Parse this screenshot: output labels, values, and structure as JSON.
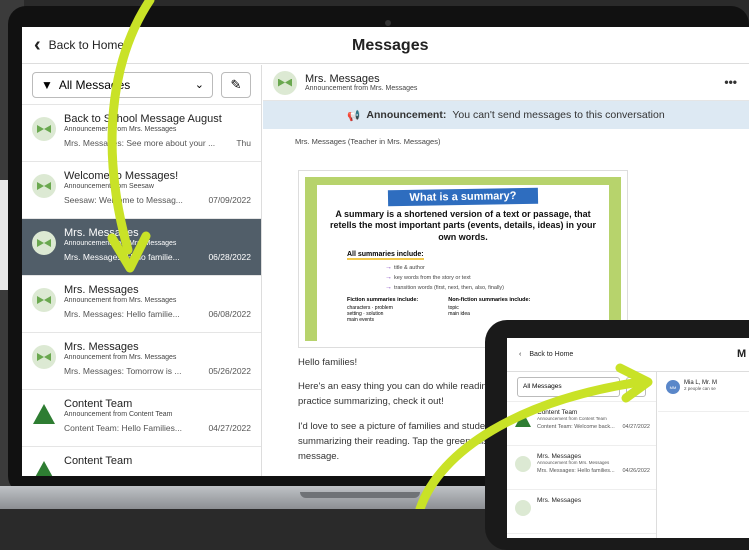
{
  "laptop": {
    "back_label": "Back to Home",
    "title": "Messages",
    "filter_label": "All Messages",
    "threads": [
      {
        "name": "Back to School Message August",
        "sub": "Announcement from Mrs. Messages",
        "preview": "Mrs. Messages: See more about your ...",
        "date": "Thu",
        "avatar": "bow"
      },
      {
        "name": "Welcome to Messages!",
        "sub": "Announcement from Seesaw",
        "preview": "Seesaw: Welcome to Messag...",
        "date": "07/09/2022",
        "avatar": "bow"
      },
      {
        "name": "Mrs. Messages",
        "sub": "Announcement from Mrs. Messages",
        "preview": "Mrs. Messages: Hello familie...",
        "date": "06/28/2022",
        "avatar": "bow"
      },
      {
        "name": "Mrs. Messages",
        "sub": "Announcement from Mrs. Messages",
        "preview": "Mrs. Messages: Hello familie...",
        "date": "06/08/2022",
        "avatar": "bow"
      },
      {
        "name": "Mrs. Messages",
        "sub": "Announcement from Mrs. Messages",
        "preview": "Mrs. Messages: Tomorrow is ...",
        "date": "05/26/2022",
        "avatar": "bow"
      },
      {
        "name": "Content Team",
        "sub": "Announcement from Content Team",
        "preview": "Content Team: Hello Families...",
        "date": "04/27/2022",
        "avatar": "tree"
      },
      {
        "name": "Content Team",
        "sub": "",
        "preview": "",
        "date": "",
        "avatar": "tree"
      }
    ],
    "conversation": {
      "name": "Mrs. Messages",
      "sub": "Announcement from Mrs. Messages",
      "more": "•••",
      "banner_bold": "Announcement:",
      "banner_text": "You can't send messages to this conversation",
      "sender": "Mrs. Messages (Teacher in Mrs. Messages)",
      "slide": {
        "title": "What is a summary?",
        "definition": "A summary is a shortened version of a text or passage, that retells the most important parts (events, details, ideas) in your own words.",
        "include_heading": "All summaries include:",
        "items": [
          "title & author",
          "key words from the story or text",
          "transition words (first, next, then, also, finally)"
        ],
        "fiction_heading": "Fiction summaries include:",
        "fiction_items": [
          "characters",
          "problem",
          "setting",
          "solution",
          "main events"
        ],
        "nonfiction_heading": "Non-fiction summaries include:",
        "nonfiction_items": [
          "topic",
          "main idea"
        ]
      },
      "body": [
        "Hello families!",
        "Here's an easy thing you can do while readin practice summarizing, check it out!",
        "I'd love to see a picture of families and stude summarizing their reading. Tap the green this message."
      ]
    }
  },
  "tablet": {
    "back_label": "Back to Home",
    "title": "M",
    "filter_label": "All Messages",
    "threads": [
      {
        "name": "Content Team",
        "sub": "Announcement from Content Team",
        "preview": "Content Team: Welcome back...",
        "date": "04/27/2022",
        "avatar": "tree"
      },
      {
        "name": "Mrs. Messages",
        "sub": "Announcement from Mrs. Messages",
        "preview": "Mrs. Messages: Hello families...",
        "date": "04/26/2022",
        "avatar": "bow"
      },
      {
        "name": "Mrs. Messages",
        "sub": "",
        "preview": "",
        "date": "",
        "avatar": "bow"
      }
    ],
    "conv_initials": "MM",
    "conv_name": "Mia L, Mr. M",
    "conv_sub": "2 people can se"
  },
  "colors": {
    "selected_row": "#515e69",
    "arrow": "#c9e227",
    "banner": "#dde9f3",
    "slide_bg": "#b7d36c",
    "slide_title": "#2e6dbf"
  },
  "icons": [
    "chevron-left-icon",
    "filter-icon",
    "chevron-down-icon",
    "compose-icon",
    "megaphone-icon",
    "more-icon"
  ]
}
